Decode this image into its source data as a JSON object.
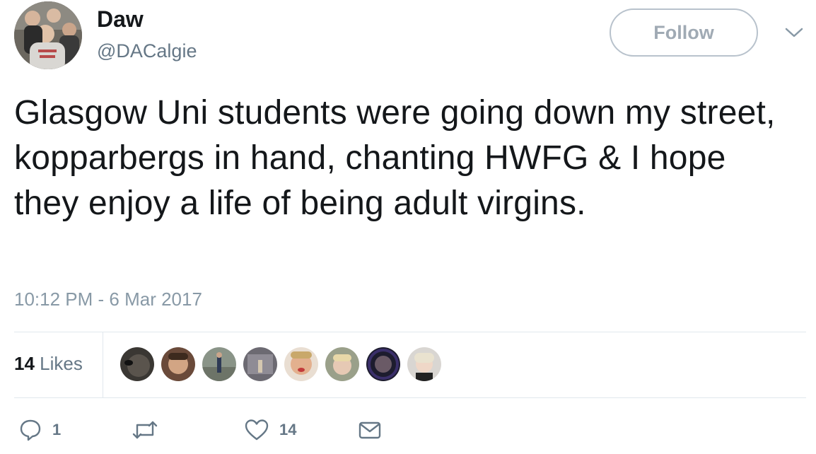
{
  "user": {
    "display_name": "Daw",
    "handle": "@DACalgie",
    "avatar_icon": "profile-photo-group"
  },
  "follow_button": {
    "label": "Follow"
  },
  "tweet": {
    "text": "Glasgow Uni students were going down my street, kopparbergs in hand, chanting HWFG & I hope they enjoy a life of being adult virgins.",
    "timestamp": "10:12 PM - 6 Mar 2017"
  },
  "stats": {
    "likes_number": "14",
    "likes_label": " Likes",
    "likers_count_shown": 8
  },
  "actions": {
    "reply_count": "1",
    "retweet_count": "",
    "like_count": "14"
  },
  "colors": {
    "text_primary": "#14171a",
    "text_secondary": "#657786",
    "timestamp": "#8899a6",
    "divider": "#e1e8ed",
    "follow_border": "#b8c2cc"
  }
}
